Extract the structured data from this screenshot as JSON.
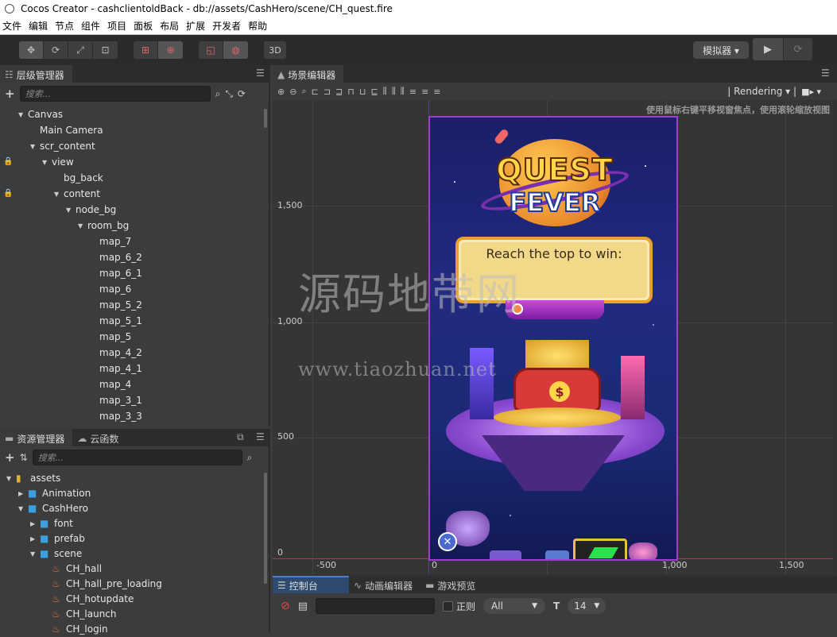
{
  "window": {
    "title": "Cocos Creator - cashclientoldBack - db://assets/CashHero/scene/CH_quest.fire"
  },
  "menu": [
    "文件",
    "编辑",
    "节点",
    "组件",
    "项目",
    "面板",
    "布局",
    "扩展",
    "开发者",
    "帮助"
  ],
  "toolbar": {
    "btn3d": "3D",
    "simulator": "模拟器 ▾"
  },
  "hierarchy": {
    "title": "层级管理器",
    "search_placeholder": "搜索...",
    "items": [
      {
        "label": "Canvas",
        "indent": 1,
        "arrow": true,
        "lock": false
      },
      {
        "label": "Main Camera",
        "indent": 2,
        "arrow": false,
        "lock": false
      },
      {
        "label": "scr_content",
        "indent": 2,
        "arrow": true,
        "lock": false
      },
      {
        "label": "view",
        "indent": 3,
        "arrow": true,
        "lock": true
      },
      {
        "label": "bg_back",
        "indent": 4,
        "arrow": false,
        "lock": false
      },
      {
        "label": "content",
        "indent": 4,
        "arrow": true,
        "lock": true
      },
      {
        "label": "node_bg",
        "indent": 5,
        "arrow": true,
        "lock": false
      },
      {
        "label": "room_bg",
        "indent": 6,
        "arrow": true,
        "lock": false
      },
      {
        "label": "map_7",
        "indent": 7,
        "arrow": false,
        "lock": false
      },
      {
        "label": "map_6_2",
        "indent": 7,
        "arrow": false,
        "lock": false
      },
      {
        "label": "map_6_1",
        "indent": 7,
        "arrow": false,
        "lock": false
      },
      {
        "label": "map_6",
        "indent": 7,
        "arrow": false,
        "lock": false
      },
      {
        "label": "map_5_2",
        "indent": 7,
        "arrow": false,
        "lock": false
      },
      {
        "label": "map_5_1",
        "indent": 7,
        "arrow": false,
        "lock": false
      },
      {
        "label": "map_5",
        "indent": 7,
        "arrow": false,
        "lock": false
      },
      {
        "label": "map_4_2",
        "indent": 7,
        "arrow": false,
        "lock": false
      },
      {
        "label": "map_4_1",
        "indent": 7,
        "arrow": false,
        "lock": false
      },
      {
        "label": "map_4",
        "indent": 7,
        "arrow": false,
        "lock": false
      },
      {
        "label": "map_3_1",
        "indent": 7,
        "arrow": false,
        "lock": false
      },
      {
        "label": "map_3_3",
        "indent": 7,
        "arrow": false,
        "lock": false
      }
    ]
  },
  "assets": {
    "tab1": "资源管理器",
    "tab2": "云函数",
    "search_placeholder": "搜索...",
    "items": [
      {
        "label": "assets",
        "indent": 0,
        "arrow": "down",
        "icon": "db"
      },
      {
        "label": "Animation",
        "indent": 1,
        "arrow": "right",
        "icon": "folder"
      },
      {
        "label": "CashHero",
        "indent": 1,
        "arrow": "down",
        "icon": "folder"
      },
      {
        "label": "font",
        "indent": 2,
        "arrow": "right",
        "icon": "folder"
      },
      {
        "label": "prefab",
        "indent": 2,
        "arrow": "right",
        "icon": "folder"
      },
      {
        "label": "scene",
        "indent": 2,
        "arrow": "down",
        "icon": "folder"
      },
      {
        "label": "CH_hall",
        "indent": 3,
        "arrow": "none",
        "icon": "fire"
      },
      {
        "label": "CH_hall_pre_loading",
        "indent": 3,
        "arrow": "none",
        "icon": "fire"
      },
      {
        "label": "CH_hotupdate",
        "indent": 3,
        "arrow": "none",
        "icon": "fire"
      },
      {
        "label": "CH_launch",
        "indent": 3,
        "arrow": "none",
        "icon": "fire"
      },
      {
        "label": "CH_login",
        "indent": 3,
        "arrow": "none",
        "icon": "fire"
      }
    ]
  },
  "scene": {
    "title": "场景编辑器",
    "rendering": "Rendering",
    "hint": "使用鼠标右键平移视窗焦点，使用滚轮缩放视图",
    "y_labels": [
      "1,500",
      "1,000",
      "500",
      "0"
    ],
    "x_labels": [
      "-500",
      "0",
      "1,000",
      "1,500"
    ],
    "game": {
      "logo_line1": "QUEST",
      "logo_line2": "FEVER",
      "banner": "Reach the top to win:",
      "close": "✕"
    }
  },
  "console": {
    "tab1": "控制台",
    "tab2": "动画编辑器",
    "tab3": "游戏预览",
    "regex_label": "正则",
    "filter": "All",
    "font_size": "14"
  },
  "watermark": {
    "line1": "源码地带网",
    "line2": "www.tiaozhuan.net"
  }
}
